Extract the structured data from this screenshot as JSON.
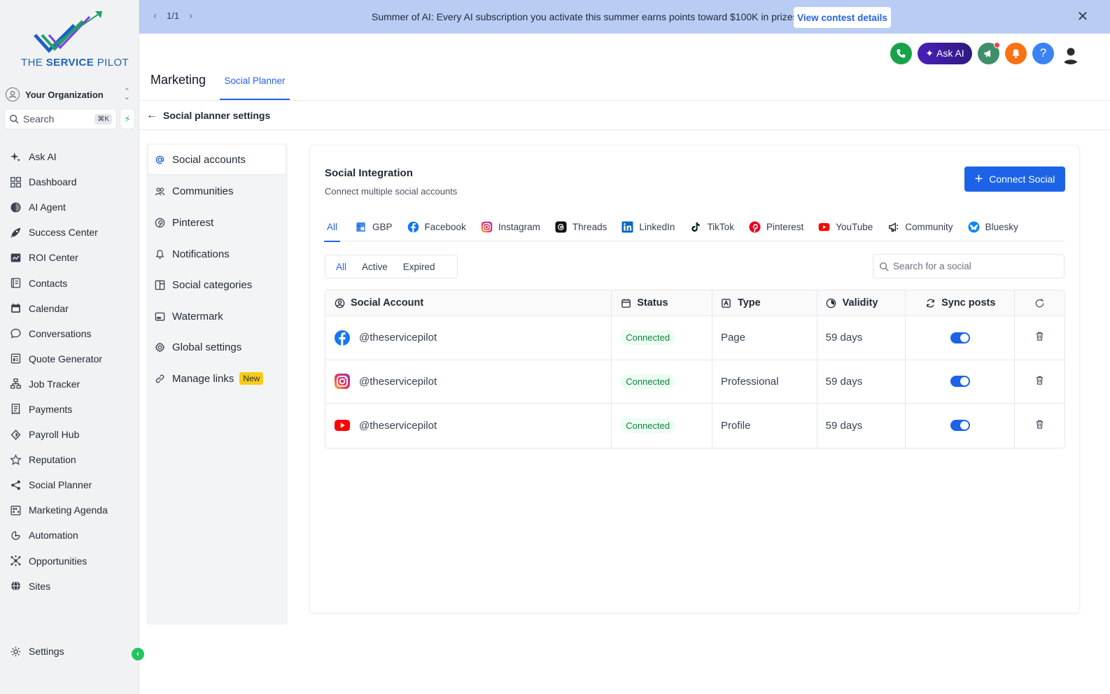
{
  "brand": {
    "logo_text_1": "THE ",
    "logo_text_2": "SERVICE",
    "logo_text_3": " PILOT"
  },
  "org": {
    "name": "Your Organization"
  },
  "search": {
    "label": "Search",
    "shortcut": "⌘K"
  },
  "nav": {
    "items": [
      {
        "label": "Ask AI",
        "icon": "sparkle-icon"
      },
      {
        "label": "Dashboard",
        "icon": "grid-icon"
      },
      {
        "label": "AI Agent",
        "icon": "half-circle-icon"
      },
      {
        "label": "Success Center",
        "icon": "rocket-icon"
      },
      {
        "label": "ROI Center",
        "icon": "chart-icon"
      },
      {
        "label": "Contacts",
        "icon": "contacts-icon"
      },
      {
        "label": "Calendar",
        "icon": "calendar-icon"
      },
      {
        "label": "Conversations",
        "icon": "chat-icon"
      },
      {
        "label": "Quote Generator",
        "icon": "quote-icon"
      },
      {
        "label": "Job Tracker",
        "icon": "hierarchy-icon"
      },
      {
        "label": "Payments",
        "icon": "receipt-icon"
      },
      {
        "label": "Payroll Hub",
        "icon": "diamond-icon"
      },
      {
        "label": "Reputation",
        "icon": "star-icon"
      },
      {
        "label": "Social Planner",
        "icon": "share-icon"
      },
      {
        "label": "Marketing Agenda",
        "icon": "agenda-icon"
      },
      {
        "label": "Automation",
        "icon": "automation-icon"
      },
      {
        "label": "Opportunities",
        "icon": "network-icon"
      },
      {
        "label": "Sites",
        "icon": "globe-icon"
      }
    ],
    "settings_label": "Settings"
  },
  "banner": {
    "pager": "1/1",
    "text": "Summer of AI: Every AI subscription you activate this summer earns points toward $100K in prizes.",
    "button": "View contest details"
  },
  "header": {
    "title": "Marketing",
    "tab": "Social Planner",
    "ask_ai": "Ask AI"
  },
  "breadcrumb": {
    "title": "Social planner settings"
  },
  "settings_menu": {
    "items": [
      {
        "label": "Social accounts",
        "icon": "at-icon"
      },
      {
        "label": "Communities",
        "icon": "users-icon"
      },
      {
        "label": "Pinterest",
        "icon": "pinterest-icon"
      },
      {
        "label": "Notifications",
        "icon": "bell-icon"
      },
      {
        "label": "Social categories",
        "icon": "columns-icon"
      },
      {
        "label": "Watermark",
        "icon": "image-icon"
      },
      {
        "label": "Global settings",
        "icon": "gear-icon"
      },
      {
        "label": "Manage links",
        "icon": "link-icon"
      }
    ],
    "new_badge": "New"
  },
  "integration": {
    "title": "Social Integration",
    "subtitle": "Connect multiple social accounts",
    "connect_button": "Connect Social",
    "platform_tabs": [
      "All",
      "GBP",
      "Facebook",
      "Instagram",
      "Threads",
      "LinkedIn",
      "TikTok",
      "Pinterest",
      "YouTube",
      "Community",
      "Bluesky"
    ],
    "filters": [
      "All",
      "Active",
      "Expired"
    ],
    "search_placeholder": "Search for a social"
  },
  "table": {
    "headers": [
      "Social Account",
      "Status",
      "Type",
      "Validity",
      "Sync posts"
    ],
    "rows": [
      {
        "platform": "facebook-icon",
        "account": "@theservicepilot",
        "status": "Connected",
        "type": "Page",
        "validity": "59 days",
        "sync": true
      },
      {
        "platform": "instagram-icon",
        "account": "@theservicepilot",
        "status": "Connected",
        "type": "Professional",
        "validity": "59 days",
        "sync": true
      },
      {
        "platform": "youtube-icon",
        "account": "@theservicepilot",
        "status": "Connected",
        "type": "Profile",
        "validity": "59 days",
        "sync": true
      }
    ]
  },
  "colors": {
    "accent": "#1d63e8",
    "banner": "#b9cdf4",
    "success": "#22c55e",
    "ask_ai": "#4a1fb8"
  }
}
